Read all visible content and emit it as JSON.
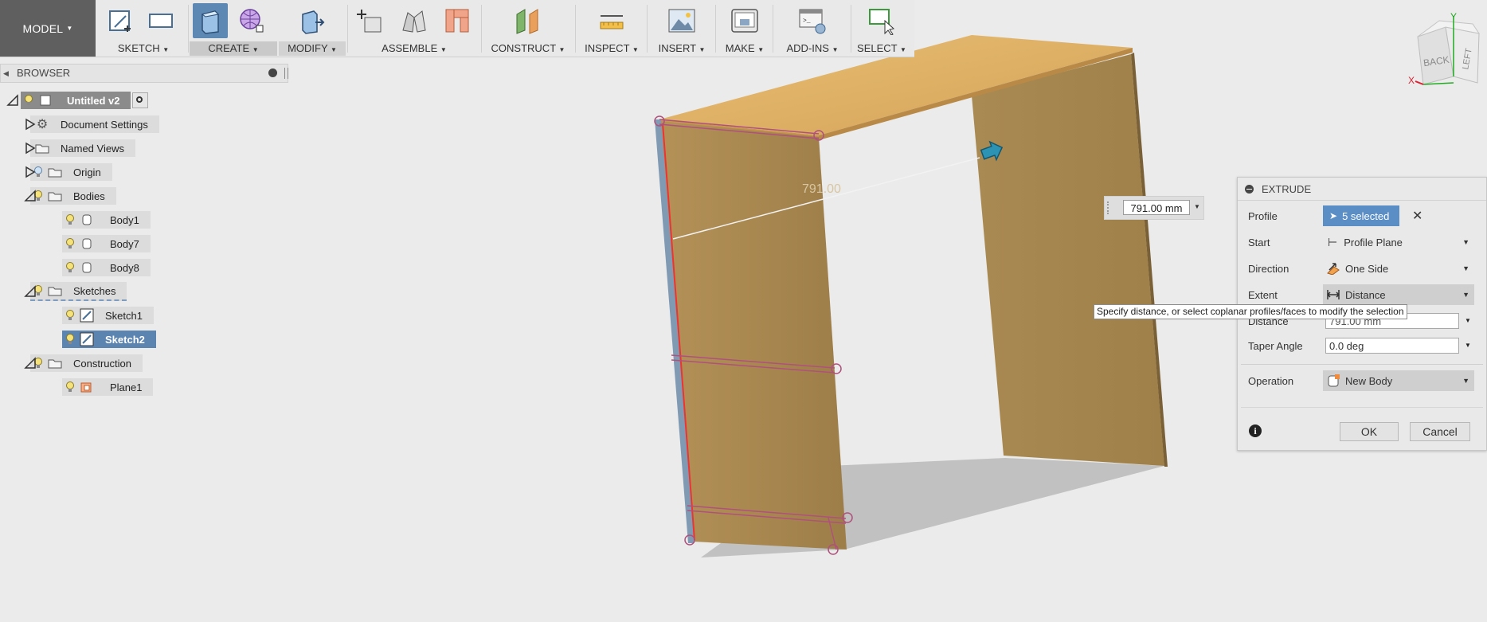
{
  "toolbar": {
    "model_label": "MODEL",
    "groups": [
      {
        "name": "sketch",
        "label": "SKETCH"
      },
      {
        "name": "create",
        "label": "CREATE"
      },
      {
        "name": "modify",
        "label": "MODIFY"
      },
      {
        "name": "assemble",
        "label": "ASSEMBLE"
      },
      {
        "name": "construct",
        "label": "CONSTRUCT"
      },
      {
        "name": "inspect",
        "label": "INSPECT"
      },
      {
        "name": "insert",
        "label": "INSERT"
      },
      {
        "name": "make",
        "label": "MAKE"
      },
      {
        "name": "add-ins",
        "label": "ADD-INS"
      },
      {
        "name": "select",
        "label": "SELECT"
      }
    ]
  },
  "browser": {
    "title": "BROWSER",
    "root": "Untitled v2",
    "items": [
      {
        "label": "Document Settings"
      },
      {
        "label": "Named Views"
      },
      {
        "label": "Origin"
      },
      {
        "label": "Bodies"
      },
      {
        "label": "Body1"
      },
      {
        "label": "Body7"
      },
      {
        "label": "Body8"
      },
      {
        "label": "Sketches"
      },
      {
        "label": "Sketch1"
      },
      {
        "label": "Sketch2"
      },
      {
        "label": "Construction"
      },
      {
        "label": "Plane1"
      }
    ]
  },
  "viewport": {
    "dimension_ghost": "791.00",
    "dimension_input": "791.00 mm",
    "viewcube": {
      "back": "BACK",
      "left": "LEFT",
      "x": "X",
      "y": "Y"
    }
  },
  "extrude": {
    "title": "EXTRUDE",
    "profile_label": "Profile",
    "profile_value": "5 selected",
    "start_label": "Start",
    "start_value": "Profile Plane",
    "direction_label": "Direction",
    "direction_value": "One Side",
    "extent_label": "Extent",
    "extent_value": "Distance",
    "distance_label": "Distance",
    "distance_value": "791.00 mm",
    "taper_label": "Taper Angle",
    "taper_value": "0.0 deg",
    "operation_label": "Operation",
    "operation_value": "New Body",
    "ok_label": "OK",
    "cancel_label": "Cancel",
    "tooltip": "Specify distance, or select coplanar profiles/faces to modify the selection"
  }
}
